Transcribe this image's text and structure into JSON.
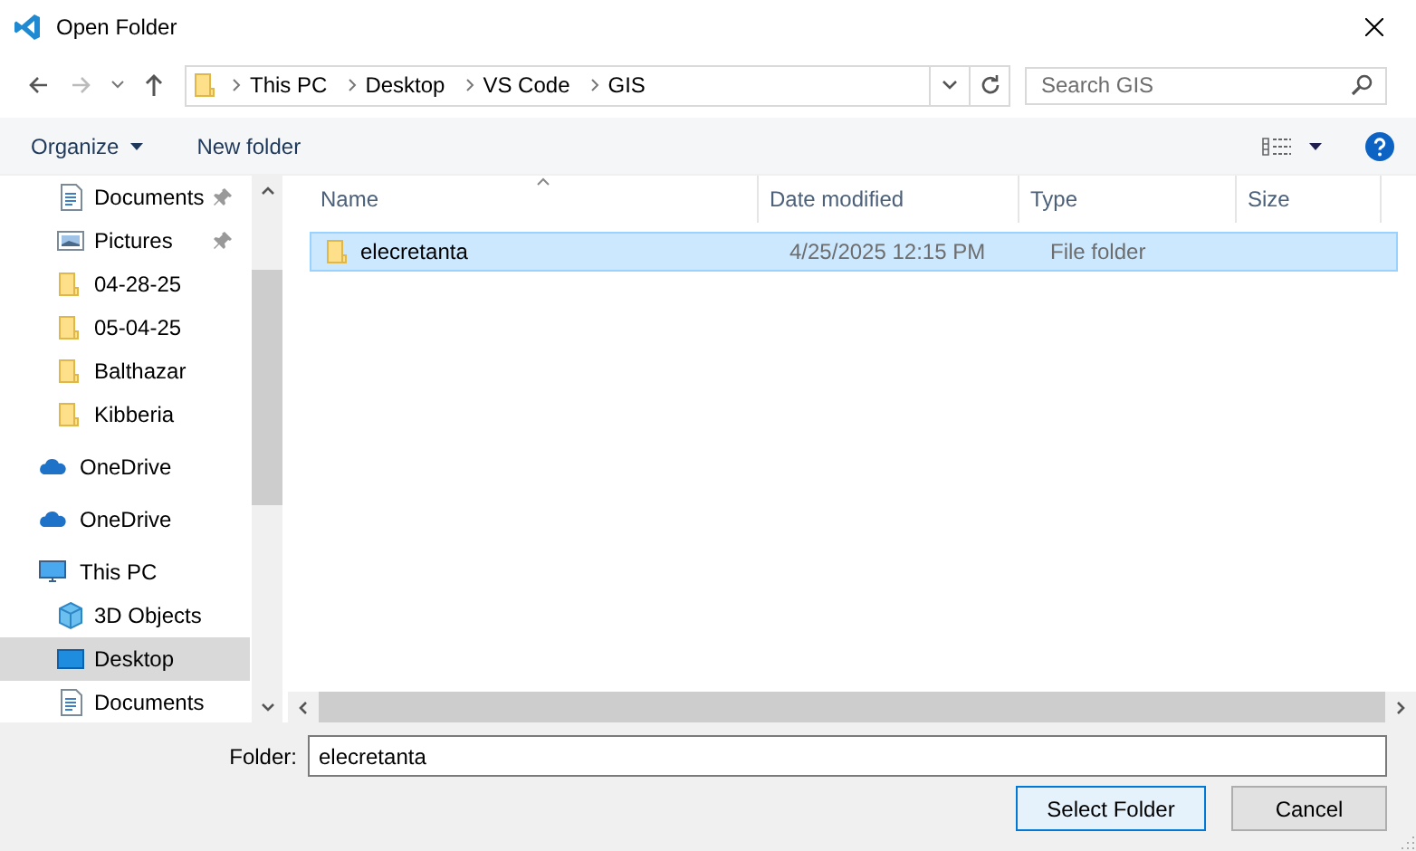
{
  "window": {
    "title": "Open Folder"
  },
  "navigation": {
    "breadcrumb": [
      "This PC",
      "Desktop",
      "VS Code",
      "GIS"
    ],
    "search": {
      "placeholder": "Search GIS"
    }
  },
  "toolbar": {
    "organize": "Organize",
    "new_folder": "New folder"
  },
  "sidebar": {
    "quick_access": [
      {
        "label": "Documents",
        "kind": "document",
        "pinned": true,
        "selected": false
      },
      {
        "label": "Pictures",
        "kind": "pictures",
        "pinned": true,
        "selected": false
      },
      {
        "label": "04-28-25",
        "kind": "folder",
        "pinned": false,
        "selected": false
      },
      {
        "label": "05-04-25",
        "kind": "folder",
        "pinned": false,
        "selected": false
      },
      {
        "label": "Balthazar",
        "kind": "folder",
        "pinned": false,
        "selected": false
      },
      {
        "label": "Kibberia",
        "kind": "folder",
        "pinned": false,
        "selected": false
      }
    ],
    "locations": [
      {
        "label": "OneDrive",
        "kind": "cloud",
        "selected": false
      },
      {
        "label": "OneDrive",
        "kind": "cloud",
        "selected": false
      },
      {
        "label": "This PC",
        "kind": "computer",
        "selected": false,
        "children": [
          {
            "label": "3D Objects",
            "kind": "objects3d",
            "selected": false
          },
          {
            "label": "Desktop",
            "kind": "desktop",
            "selected": true
          },
          {
            "label": "Documents",
            "kind": "document",
            "selected": false
          }
        ]
      }
    ]
  },
  "file_list": {
    "columns": [
      {
        "label": "Name",
        "sorted": true
      },
      {
        "label": "Date modified",
        "sorted": false
      },
      {
        "label": "Type",
        "sorted": false
      },
      {
        "label": "Size",
        "sorted": false
      }
    ],
    "rows": [
      {
        "name": "elecretanta",
        "date_modified": "4/25/2025 12:15 PM",
        "type": "File folder",
        "selected": true
      }
    ]
  },
  "footer": {
    "folder_label": "Folder:",
    "folder_value": "elecretanta",
    "buttons": [
      {
        "label": "Select Folder",
        "kind": "primary"
      },
      {
        "label": "Cancel",
        "kind": "secondary"
      }
    ]
  }
}
